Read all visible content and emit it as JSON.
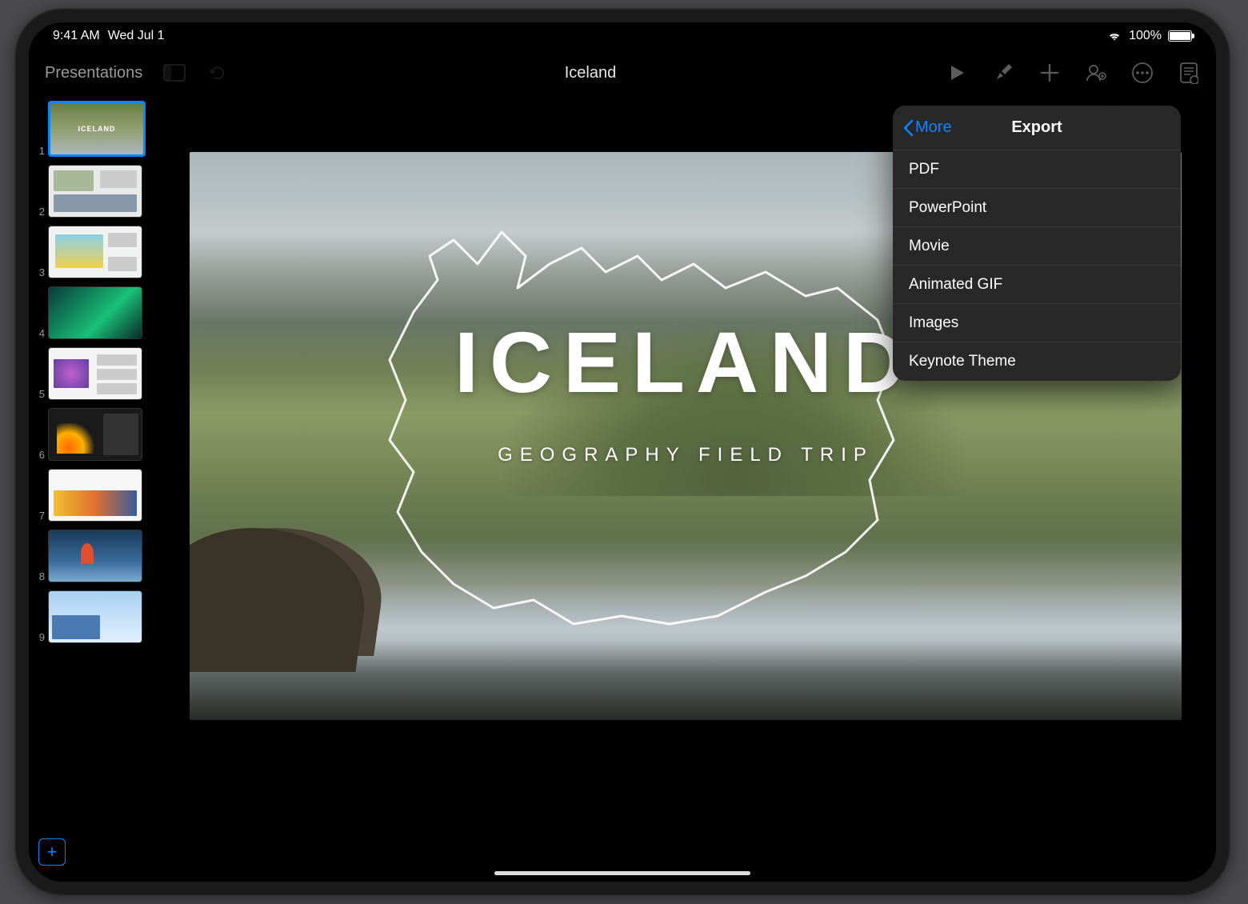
{
  "status": {
    "time": "9:41 AM",
    "date": "Wed Jul 1",
    "battery_pct": "100%"
  },
  "toolbar": {
    "back_label": "Presentations",
    "document_title": "Iceland"
  },
  "navigator": {
    "selected_index": 1,
    "slides": [
      {
        "num": "1"
      },
      {
        "num": "2"
      },
      {
        "num": "3"
      },
      {
        "num": "4"
      },
      {
        "num": "5"
      },
      {
        "num": "6"
      },
      {
        "num": "7"
      },
      {
        "num": "8"
      },
      {
        "num": "9"
      }
    ]
  },
  "slide": {
    "title": "ICELAND",
    "subtitle": "GEOGRAPHY FIELD TRIP"
  },
  "popover": {
    "back_label": "More",
    "title": "Export",
    "items": [
      "PDF",
      "PowerPoint",
      "Movie",
      "Animated GIF",
      "Images",
      "Keynote Theme"
    ]
  }
}
